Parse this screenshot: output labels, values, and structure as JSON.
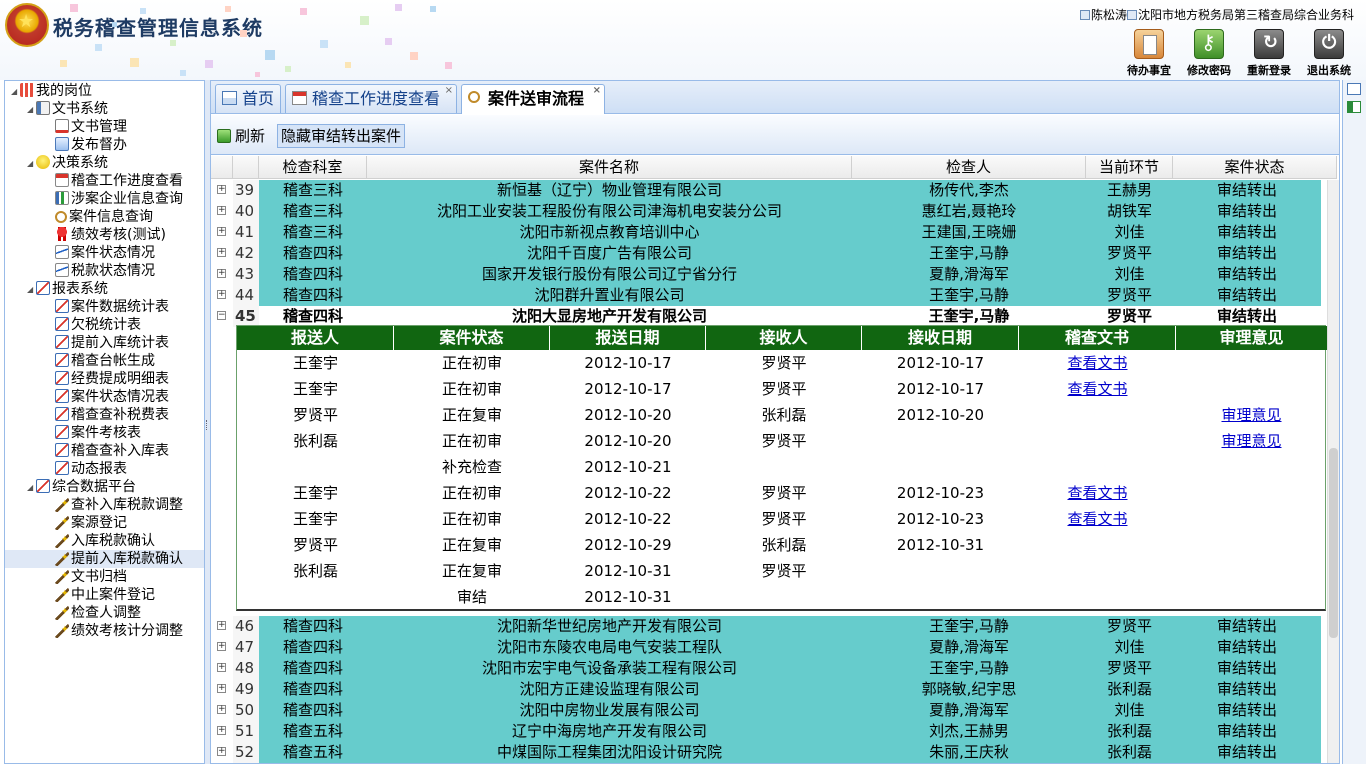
{
  "header": {
    "app_title": "税务稽查管理信息系统",
    "user_name": "陈松涛",
    "org": "沈阳市地方税务局第三稽查局综合业务科",
    "buttons": {
      "todo": "待办事宜",
      "change_password": "修改密码",
      "relogin": "重新登录",
      "exit": "退出系统"
    }
  },
  "sidebar": {
    "root": "我的岗位",
    "groups": [
      {
        "label": "文书系统",
        "items": [
          "文书管理",
          "发布督办"
        ]
      },
      {
        "label": "决策系统",
        "items": [
          "稽查工作进度查看",
          "涉案企业信息查询",
          "案件信息查询",
          "绩效考核(测试)",
          "案件状态情况",
          "税款状态情况"
        ]
      },
      {
        "label": "报表系统",
        "items": [
          "案件数据统计表",
          "欠税统计表",
          "提前入库统计表",
          "稽查台帐生成",
          "经费提成明细表",
          "案件状态情况表",
          "稽查查补税费表",
          "案件考核表",
          "稽查查补入库表",
          "动态报表"
        ]
      },
      {
        "label": "综合数据平台",
        "items": [
          "查补入库税款调整",
          "案源登记",
          "入库税款确认",
          "提前入库税款确认",
          "文书归档",
          "中止案件登记",
          "检查人调整",
          "绩效考核计分调整"
        ]
      }
    ],
    "selected": "提前入库税款确认"
  },
  "tabs": [
    {
      "label": "首页",
      "closable": false
    },
    {
      "label": "稽查工作进度查看",
      "closable": true
    },
    {
      "label": "案件送审流程",
      "closable": true,
      "active": true
    }
  ],
  "toolbar": {
    "refresh": "刷新",
    "hide_closed": "隐藏审结转出案件"
  },
  "grid": {
    "columns": [
      "检查科室",
      "案件名称",
      "检查人",
      "当前环节",
      "案件状态"
    ],
    "rows_before": [
      {
        "no": "39",
        "dept": "稽查三科",
        "name": "新恒基（辽宁）物业管理有限公司",
        "inspector": "杨传代,李杰",
        "stage": "王赫男",
        "status": "审结转出"
      },
      {
        "no": "40",
        "dept": "稽查三科",
        "name": "沈阳工业安装工程股份有限公司津海机电安装分公司",
        "inspector": "惠红岩,聂艳玲",
        "stage": "胡铁军",
        "status": "审结转出"
      },
      {
        "no": "41",
        "dept": "稽查三科",
        "name": "沈阳市新视点教育培训中心",
        "inspector": "王建国,王晓姗",
        "stage": "刘佳",
        "status": "审结转出"
      },
      {
        "no": "42",
        "dept": "稽查四科",
        "name": "沈阳千百度广告有限公司",
        "inspector": "王奎宇,马静",
        "stage": "罗贤平",
        "status": "审结转出"
      },
      {
        "no": "43",
        "dept": "稽查四科",
        "name": "国家开发银行股份有限公司辽宁省分行",
        "inspector": "夏静,滑海军",
        "stage": "刘佳",
        "status": "审结转出"
      },
      {
        "no": "44",
        "dept": "稽查四科",
        "name": "沈阳群升置业有限公司",
        "inspector": "王奎宇,马静",
        "stage": "罗贤平",
        "status": "审结转出"
      }
    ],
    "expanded_row": {
      "no": "45",
      "dept": "稽查四科",
      "name": "沈阳大显房地产开发有限公司",
      "inspector": "王奎宇,马静",
      "stage": "罗贤平",
      "status": "审结转出"
    },
    "rows_after": [
      {
        "no": "46",
        "dept": "稽查四科",
        "name": "沈阳新华世纪房地产开发有限公司",
        "inspector": "王奎宇,马静",
        "stage": "罗贤平",
        "status": "审结转出"
      },
      {
        "no": "47",
        "dept": "稽查四科",
        "name": "沈阳市东陵农电局电气安装工程队",
        "inspector": "夏静,滑海军",
        "stage": "刘佳",
        "status": "审结转出"
      },
      {
        "no": "48",
        "dept": "稽查四科",
        "name": "沈阳市宏宇电气设备承装工程有限公司",
        "inspector": "王奎宇,马静",
        "stage": "罗贤平",
        "status": "审结转出"
      },
      {
        "no": "49",
        "dept": "稽查四科",
        "name": "沈阳方正建设监理有限公司",
        "inspector": "郭晓敏,纪宇思",
        "stage": "张利磊",
        "status": "审结转出"
      },
      {
        "no": "50",
        "dept": "稽查四科",
        "name": "沈阳中房物业发展有限公司",
        "inspector": "夏静,滑海军",
        "stage": "刘佳",
        "status": "审结转出"
      },
      {
        "no": "51",
        "dept": "稽查五科",
        "name": "辽宁中海房地产开发有限公司",
        "inspector": "刘杰,王赫男",
        "stage": "张利磊",
        "status": "审结转出"
      },
      {
        "no": "52",
        "dept": "稽查五科",
        "name": "中煤国际工程集团沈阳设计研究院",
        "inspector": "朱丽,王庆秋",
        "stage": "张利磊",
        "status": "审结转出"
      }
    ]
  },
  "detail": {
    "columns": [
      "报送人",
      "案件状态",
      "报送日期",
      "接收人",
      "接收日期",
      "稽查文书",
      "审理意见"
    ],
    "rows": [
      {
        "sender": "王奎宇",
        "state": "正在初审",
        "send_date": "2012-10-17",
        "receiver": "罗贤平",
        "recv_date": "2012-10-17",
        "doc": "查看文书",
        "opinion": ""
      },
      {
        "sender": "王奎宇",
        "state": "正在初审",
        "send_date": "2012-10-17",
        "receiver": "罗贤平",
        "recv_date": "2012-10-17",
        "doc": "查看文书",
        "opinion": ""
      },
      {
        "sender": "罗贤平",
        "state": "正在复审",
        "send_date": "2012-10-20",
        "receiver": "张利磊",
        "recv_date": "2012-10-20",
        "doc": "",
        "opinion": "审理意见"
      },
      {
        "sender": "张利磊",
        "state": "正在初审",
        "send_date": "2012-10-20",
        "receiver": "罗贤平",
        "recv_date": "",
        "doc": "",
        "opinion": "审理意见"
      },
      {
        "sender": "",
        "state": "补充检查",
        "send_date": "2012-10-21",
        "receiver": "",
        "recv_date": "",
        "doc": "",
        "opinion": ""
      },
      {
        "sender": "王奎宇",
        "state": "正在初审",
        "send_date": "2012-10-22",
        "receiver": "罗贤平",
        "recv_date": "2012-10-23",
        "doc": "查看文书",
        "opinion": ""
      },
      {
        "sender": "王奎宇",
        "state": "正在初审",
        "send_date": "2012-10-22",
        "receiver": "罗贤平",
        "recv_date": "2012-10-23",
        "doc": "查看文书",
        "opinion": ""
      },
      {
        "sender": "罗贤平",
        "state": "正在复审",
        "send_date": "2012-10-29",
        "receiver": "张利磊",
        "recv_date": "2012-10-31",
        "doc": "",
        "opinion": ""
      },
      {
        "sender": "张利磊",
        "state": "正在复审",
        "send_date": "2012-10-31",
        "receiver": "罗贤平",
        "recv_date": "",
        "doc": "",
        "opinion": ""
      },
      {
        "sender": "",
        "state": "审结",
        "send_date": "2012-10-31",
        "receiver": "",
        "recv_date": "",
        "doc": "",
        "opinion": ""
      }
    ]
  },
  "colors": {
    "row_bg": "#66cccc",
    "detail_header": "#116611",
    "title": "#1e3b63",
    "link": "#0000cc"
  }
}
